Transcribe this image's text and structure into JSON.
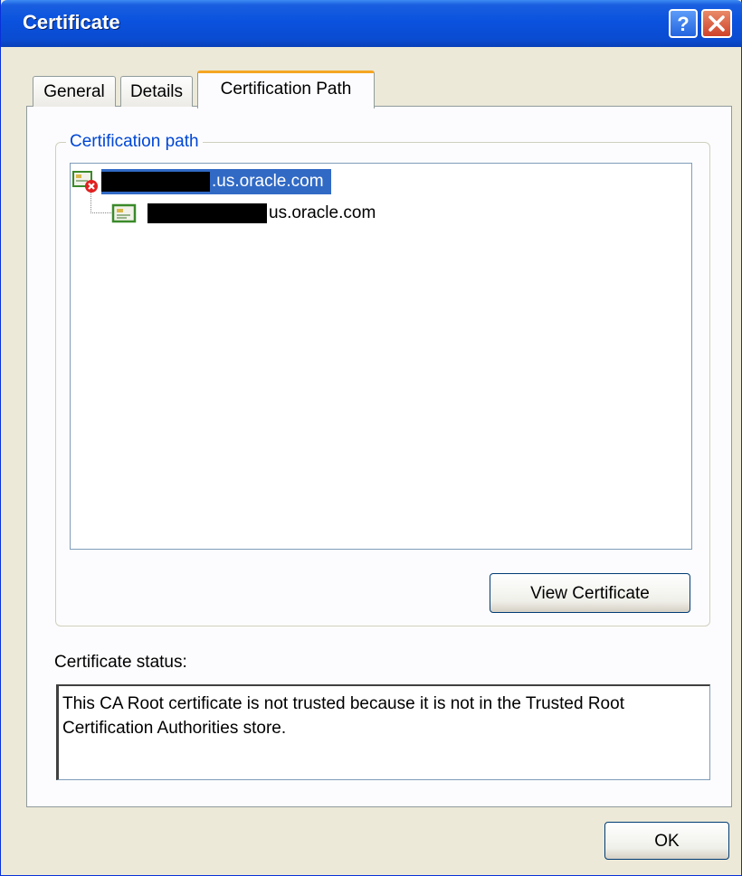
{
  "window": {
    "title": "Certificate"
  },
  "titlebar_buttons": {
    "help": "?",
    "close": "✕"
  },
  "tabs": [
    {
      "label": "General",
      "selected": false
    },
    {
      "label": "Details",
      "selected": false
    },
    {
      "label": "Certification Path",
      "selected": true
    }
  ],
  "cert_path": {
    "group_label": "Certification path",
    "items": [
      {
        "label": ".us.oracle.com",
        "icon": "certificate-error-icon",
        "selected": true
      },
      {
        "label": "us.oracle.com",
        "icon": "certificate-icon",
        "selected": false
      }
    ],
    "view_button": "View Certificate"
  },
  "status": {
    "label": "Certificate status:",
    "text": "This CA Root certificate is not trusted because it is not in the Trusted Root Certification Authorities store."
  },
  "ok_button": "OK",
  "colors": {
    "titlebar": "#0a52de",
    "selection": "#316ac5",
    "groupbox_label": "#0046d5",
    "active_tab_accent": "#f5a623"
  }
}
